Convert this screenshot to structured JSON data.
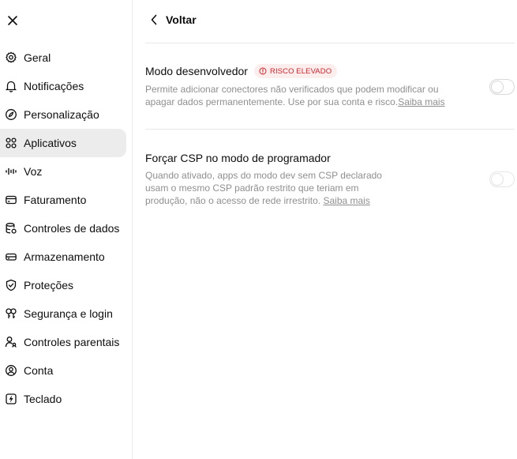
{
  "sidebar": {
    "close_icon": "close-icon",
    "items": [
      {
        "label": "Geral",
        "icon": "gear-icon"
      },
      {
        "label": "Notificações",
        "icon": "bell-icon"
      },
      {
        "label": "Personalização",
        "icon": "personalization-icon"
      },
      {
        "label": "Aplicativos",
        "icon": "apps-grid-icon",
        "active": true
      },
      {
        "label": "Voz",
        "icon": "waveform-icon"
      },
      {
        "label": "Faturamento",
        "icon": "credit-card-icon"
      },
      {
        "label": "Controles de dados",
        "icon": "database-icon"
      },
      {
        "label": "Armazenamento",
        "icon": "storage-icon"
      },
      {
        "label": "Proteções",
        "icon": "shield-icon"
      },
      {
        "label": "Segurança e login",
        "icon": "key-icon"
      },
      {
        "label": "Controles parentais",
        "icon": "parental-icon"
      },
      {
        "label": "Conta",
        "icon": "user-circle-icon"
      },
      {
        "label": "Teclado",
        "icon": "keyboard-icon"
      }
    ]
  },
  "header": {
    "back_label": "Voltar"
  },
  "settings": {
    "developer_mode": {
      "title": "Modo desenvolvedor",
      "badge": "RISCO ELEVADO",
      "desc_line1": "Permite adicionar conectores não verificados que podem modificar ou",
      "desc_line2": "apagar dados permanentemente. Use por sua conta e risco.",
      "link": "Saiba mais",
      "enabled": false
    },
    "csp": {
      "title": "Forçar CSP no modo de programador",
      "desc_line1": "Quando ativado, apps do modo dev sem CSP declarado",
      "desc_line2": "usam o mesmo CSP padrão restrito que teriam em",
      "desc_line3": "produção, não o acesso de rede irrestrito. ",
      "link": "Saiba mais",
      "enabled": false
    }
  },
  "colors": {
    "badge_text": "#d2232a",
    "badge_bg": "#fdeeee",
    "active_item_bg": "#ececec"
  }
}
